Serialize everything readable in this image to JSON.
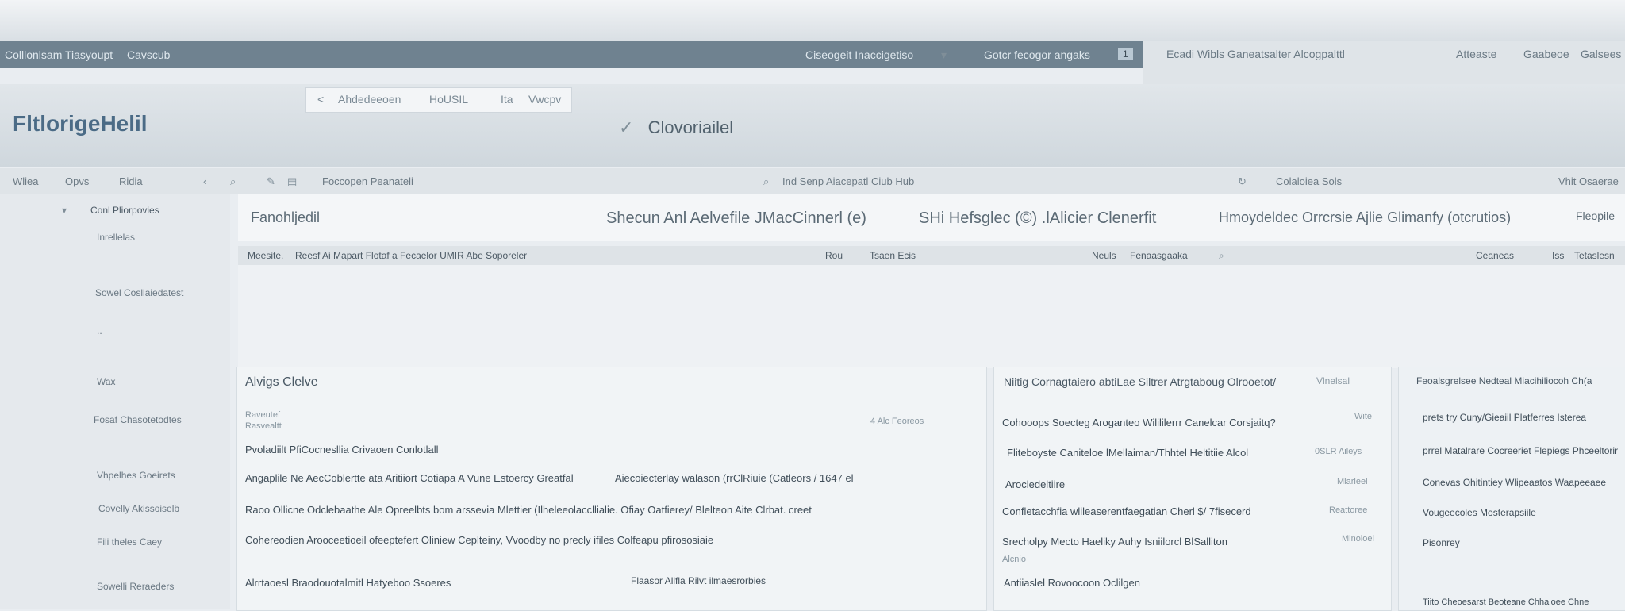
{
  "navbar": {
    "left_items": [
      "Colllonlsam",
      "Tiasyoupt",
      "Cavscub"
    ],
    "center_label": "Ciseogeit Inaccigetiso",
    "center_search": "Gotcr fecogor angaks",
    "center_tag": "1",
    "right_label": "Ecadi Wibls Ganeatsalter Alcogpalttl",
    "right_items": [
      "Atteaste",
      "Gaabeoe",
      "Galsees"
    ]
  },
  "breadcrumb": {
    "back": "<",
    "items": [
      "Ahdedeeoen",
      "HoUSIL",
      "Ita",
      "Vwcpv"
    ]
  },
  "header": {
    "brand": "FltlorigeHelil",
    "center_title": "Clovoriailel"
  },
  "toolbar": {
    "items": [
      "Wliea",
      "Opvs",
      "Ridia"
    ],
    "file_label": "Foccopen Peanateli",
    "center_label": "Ind Senp Aiacepatl Ciub Hub",
    "right_label": "Colaloiea Sols",
    "far_right": "Vhit Osaerae"
  },
  "sidebar": {
    "section": "Conl Pliorpovies",
    "items": [
      "Inrellelas",
      "Sowel Cosllaiedatest",
      "..",
      "Wax",
      "Fosaf Chasotetodtes",
      "Vhpelhes Goeirets",
      "Covelly Akissoiselb",
      "Fili theles Caey",
      "Sowelli Reraeders"
    ]
  },
  "columns": {
    "c1": "Fanohljedil",
    "c2": "Shecun Anl Aelvefile JMacCinnerl (e)",
    "c3": "SHi Hefsglec (©) .lAlicier Clenerfit",
    "c4": "Hmoydeldec Orrcrsie Ajlie Glimanfy (otcrutios)",
    "c5": "Fleopile"
  },
  "filterbar": {
    "label": "Meesite.",
    "text": "Reesf Ai Mapart Flotaf a Fecaelor UMIR Abe Soporeler",
    "mid1": "Rou",
    "mid2": "Tsaen Ecis",
    "right1": "Neuls",
    "right2": "Fenaasgaaka",
    "right3": "Ceaneas",
    "right4": "Iss",
    "right5": "Tetaslesn"
  },
  "panel1": {
    "title": "Alvigs Clelve",
    "sub1": "Raveutef",
    "sub2": "Rasvealtt",
    "meta": "4 Alc Feoreos",
    "line1": "Pvoladiilt PfiCocnesllia Crivaoen Conlotlall",
    "line2": "Angaplile Ne AecCoblertte ata Aritiiort Cotiapa A Vune Estoercy Greatfal",
    "line2b": "Aiecoiecterlay walason (rrClRiuie (Catleors / 1647 el",
    "line3": "Raoo Ollicne Odclebaathe Ale Opreelbts bom arssevia Mlettier (Ilheleeolaccllialie. Ofiay Oatfierey/ Blelteon Aite Clrbat. creet",
    "line4": "Cohereodien Arooceetioeil ofeeptefert Oliniew Ceplteiny, Vvoodby no precly ifiles Colfeapu pfirososiaie",
    "footer1": "Alrrtaoesl Braodouotalmitl Hatyeboo Ssoeres",
    "footer2": "Flaasor Allfla Rilvt ilmaesrorbies"
  },
  "panel2": {
    "title": "Niitig Cornagtaiero abtiLae Siltrer Atrgtaboug Olrooetot/",
    "title_tag": "Vlnelsal",
    "r1": "Cohooops Soecteg Aroganteo Wilililerrr Canelcar Corsjaitq?",
    "r1tag": "Wite",
    "r2": "Fliteboyste Caniteloe lMellaiman/Thhtel Heltitiie Alcol",
    "r2tag": "0SLR Aileys",
    "r3": "Arocledeltiire",
    "r3tag": "Mlarleel",
    "r4": "Confletacchfia wlileaserentfaegatian Cherl $/ 7fisecerd",
    "r4tag": "Reattoree",
    "r5": "Srecholpy Mecto Haeliky Auhy Isniilorcl BlSalliton",
    "r5tag": "Mlnoioel",
    "r5sub": "Alcnio",
    "footer": "Antiiaslel Rovoocoon Oclilgen"
  },
  "panel3": {
    "title": "Feoalsgrelsee Nedteal Miacihiliocoh Ch(a",
    "r1": "prets try Cuny/Gieaiil Platferres Isterea",
    "r2": "prrel Matalrare Cocreeriet Flepiegs Phceeltorir",
    "r3": "Conevas Ohitintiey Wlipeaatos Waapeeaee",
    "r4": "Vougeecoles Mosterapsiile",
    "r5": "Pisonrey",
    "footer": "Tiito Cheoesarst Beoteane Chhaloee Chne"
  },
  "icons": {
    "chevron": "chevron-down-icon",
    "search": "search-icon",
    "check": "check-icon",
    "gear": "gear-icon"
  }
}
